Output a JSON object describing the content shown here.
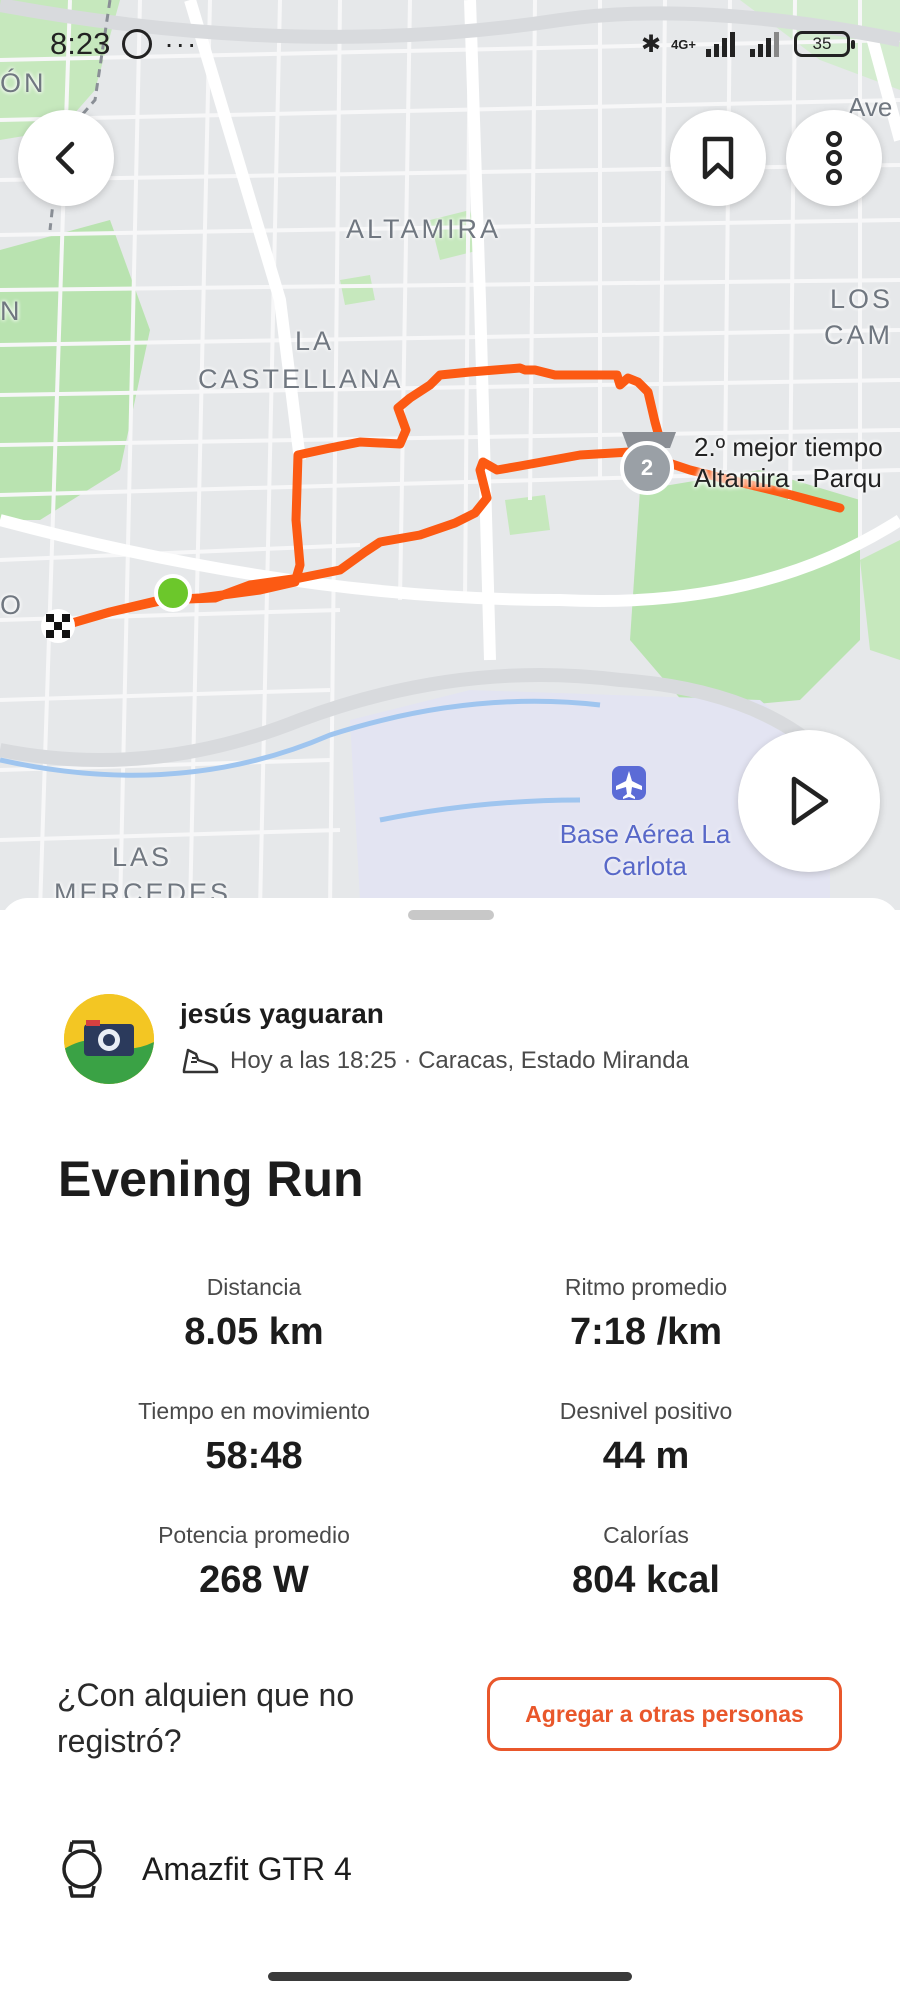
{
  "status_bar": {
    "time": "8:23",
    "battery": "35",
    "network": "4G+"
  },
  "map": {
    "labels": {
      "altamira": "ALTAMIRA",
      "la": "LA",
      "castellana": "CASTELLANA",
      "los": "LOS",
      "cam": "CAM",
      "las": "LAS",
      "mercedes": "MERCEDES",
      "ave": "Ave",
      "on": "ÓN",
      "n": "N",
      "o": "O"
    },
    "segment_badge": "2",
    "segment_label_line1": "2.º mejor tiempo",
    "segment_label_line2": "Altamira - Parqu",
    "airport_line1": "Base Aérea La",
    "airport_line2": "Carlota",
    "route_color": "#fc5a13",
    "start_marker_color": "#6cc72b"
  },
  "activity": {
    "athlete_name": "jesús yaguaran",
    "meta": "Hoy a las 18:25 · Caracas, Estado Miranda",
    "title": "Evening Run",
    "stats": [
      {
        "label": "Distancia",
        "value": "8.05 km"
      },
      {
        "label": "Ritmo promedio",
        "value": "7:18 /km"
      },
      {
        "label": "Tiempo en movimiento",
        "value": "58:48"
      },
      {
        "label": "Desnivel positivo",
        "value": "44 m"
      },
      {
        "label": "Potencia promedio",
        "value": "268 W"
      },
      {
        "label": "Calorías",
        "value": "804 kcal"
      }
    ],
    "question": "¿Con alquien que no registró?",
    "add_button": "Agregar a otras personas",
    "device": "Amazfit GTR 4"
  },
  "colors": {
    "accent": "#e9572b"
  }
}
